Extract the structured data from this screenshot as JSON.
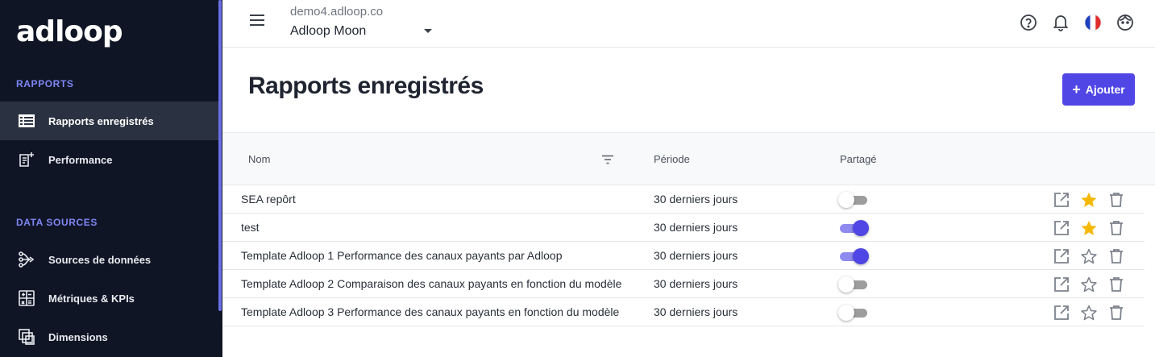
{
  "sidebar": {
    "logo": "adloop",
    "sections": [
      {
        "title": "RAPPORTS"
      },
      {
        "title": "DATA SOURCES"
      }
    ],
    "items": [
      {
        "label": "Rapports enregistrés",
        "icon": "list-icon",
        "active": true
      },
      {
        "label": "Performance",
        "icon": "report-add-icon",
        "active": false
      },
      {
        "label": "Sources de données",
        "icon": "sources-icon",
        "active": false
      },
      {
        "label": "Métriques & KPIs",
        "icon": "calculator-icon",
        "active": false
      },
      {
        "label": "Dimensions",
        "icon": "dimensions-icon",
        "active": false
      }
    ]
  },
  "header": {
    "domain": "demo4.adloop.co",
    "account": "Adloop Moon",
    "icons": [
      "help-icon",
      "bell-icon",
      "france-flag-icon",
      "user-face-icon"
    ]
  },
  "main": {
    "title": "Rapports enregistrés",
    "add_label": "Ajouter",
    "columns": {
      "name": "Nom",
      "period": "Période",
      "shared": "Partagé"
    },
    "rows": [
      {
        "name": "SEA repôrt",
        "period": "30 derniers jours",
        "shared": false,
        "favorite": true
      },
      {
        "name": "test",
        "period": "30 derniers jours",
        "shared": true,
        "favorite": true
      },
      {
        "name": "Template Adloop 1 Performance des canaux payants par Adloop",
        "period": "30 derniers jours",
        "shared": true,
        "favorite": false
      },
      {
        "name": "Template Adloop 2 Comparaison des canaux payants en fonction du modèle",
        "period": "30 derniers jours",
        "shared": false,
        "favorite": false
      },
      {
        "name": "Template Adloop 3 Performance des canaux payants en fonction du modèle",
        "period": "30 derniers jours",
        "shared": false,
        "favorite": false
      }
    ]
  },
  "colors": {
    "sidebar_bg": "#0f1524",
    "accent": "#4f46e5",
    "section_title": "#7f86f5",
    "star": "#f5b800"
  }
}
